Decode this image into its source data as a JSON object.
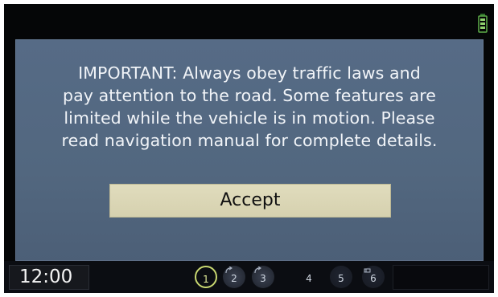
{
  "dialog": {
    "message_lines": [
      "IMPORTANT: Always obey traffic laws and",
      "pay attention to the road.  Some features are",
      "limited while the vehicle is in motion.  Please",
      "read navigation manual for complete details."
    ],
    "accept_label": "Accept"
  },
  "status_bar": {
    "clock": "12:00",
    "presets": [
      "1",
      "2",
      "3",
      "4",
      "5",
      "6"
    ],
    "active_preset": "1"
  },
  "colors": {
    "dialog_bg": "#566b86",
    "button_bg": "#ddd9ba",
    "screen_bg": "#050607",
    "active_ring": "#c8d770"
  },
  "icons": {
    "status": "signal-battery-icon",
    "preset_arrow": "cd-track-arrow-icon"
  }
}
